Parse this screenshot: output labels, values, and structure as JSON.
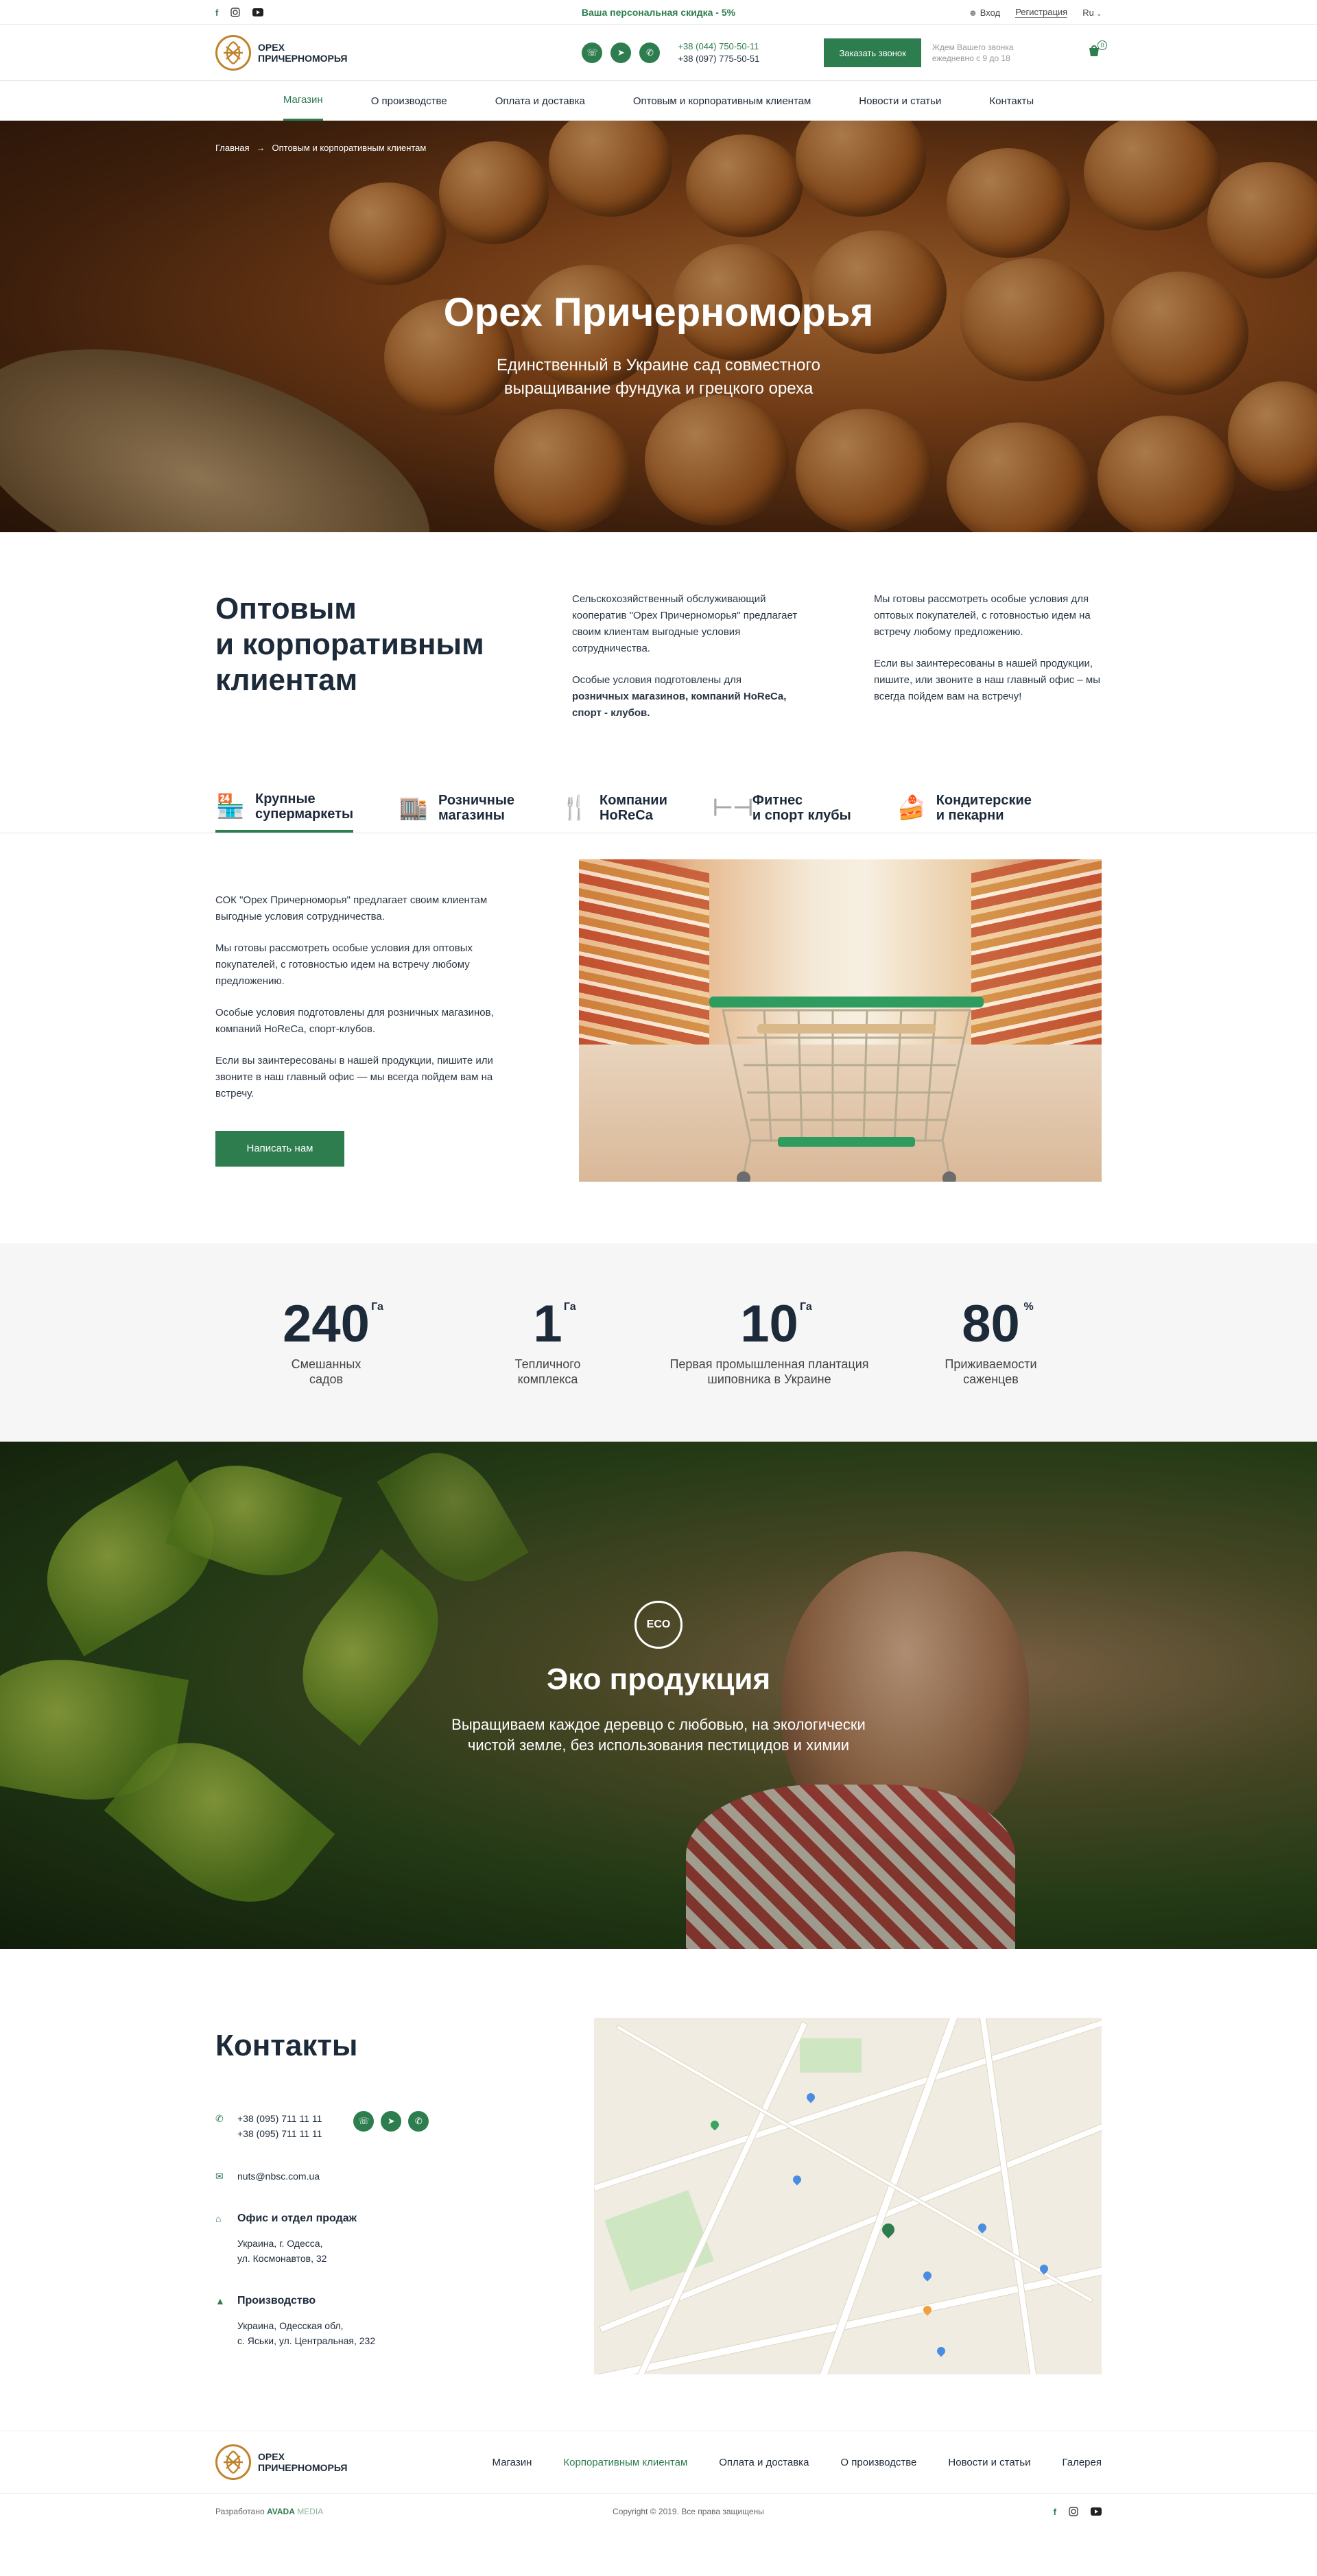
{
  "topbar": {
    "promo": "Ваша персональная скидка - 5%",
    "login": "Вход",
    "register": "Регистрация",
    "lang": "Ru"
  },
  "header": {
    "logo_line1": "ОРЕХ",
    "logo_line2": "ПРИЧЕРНОМОРЬЯ",
    "phone1": "+38 (044) 750-50-11",
    "phone2": "+38 (097) 775-50-51",
    "call_button": "Заказать звонок",
    "wait_text": "Ждем Вашего звонка ежедневно с 9 до 18",
    "cart_count": "0"
  },
  "nav": [
    {
      "label": "Магазин"
    },
    {
      "label": "О производстве"
    },
    {
      "label": "Оплата и доставка"
    },
    {
      "label": "Оптовым и корпоративным клиентам"
    },
    {
      "label": "Новости и статьи"
    },
    {
      "label": "Контакты"
    }
  ],
  "hero": {
    "crumb_home": "Главная",
    "crumb_current": "Оптовым и корпоративным клиентам",
    "title": "Орех Причерноморья",
    "subtitle_1": "Единственный в Украине сад совместного",
    "subtitle_2": "выращивание фундука и грецкого ореха"
  },
  "wholesale": {
    "title_1": "Оптовым",
    "title_2": "и корпоративным",
    "title_3": "клиентам",
    "col1_p1": "Сельскохозяйственный обслуживающий кооператив \"Орех Причерноморья\" предлагает своим клиентам выгодные условия сотрудничества.",
    "col1_p2a": "Особые условия подготовлены для ",
    "col1_p2b": "розничных магазинов, компаний HoReCa, спорт - клубов.",
    "col2_p1": "Мы готовы рассмотреть особые условия для оптовых покупателей, с готовностью идем на встречу любому предложению.",
    "col2_p2": "Если вы заинтересованы в нашей продукции, пишите, или звоните в наш главный офис – мы всегда пойдем вам на встречу!"
  },
  "tabs": [
    {
      "l1": "Крупные",
      "l2": "супермаркеты"
    },
    {
      "l1": "Розничные",
      "l2": "магазины"
    },
    {
      "l1": "Компании",
      "l2": "HoReCa"
    },
    {
      "l1": "Фитнес",
      "l2": "и спорт клубы"
    },
    {
      "l1": "Кондитерские",
      "l2": "и пекарни"
    }
  ],
  "tab_content": {
    "p1": "СОК \"Орех Причерноморья\" предлагает своим клиентам выгодные условия сотрудничества.",
    "p2": "Мы готовы рассмотреть особые условия для оптовых покупателей, с готовностью идем на встречу любому предложению.",
    "p3": "Особые условия подготовлены для розничных магазинов, компаний HoReCa, спорт-клубов.",
    "p4": "Если вы заинтересованы в нашей продукции, пишите или звоните в наш главный офис — мы всегда пойдем вам на встречу.",
    "button": "Написать нам"
  },
  "stats": [
    {
      "num": "240",
      "unit": "Га",
      "l1": "Смешанных",
      "l2": "садов"
    },
    {
      "num": "1",
      "unit": "Га",
      "l1": "Тепличного",
      "l2": "комплекса"
    },
    {
      "num": "10",
      "unit": "Га",
      "l1": "Первая промышленная плантация",
      "l2": "шиповника в Украине"
    },
    {
      "num": "80",
      "unit": "%",
      "l1": "Приживаемости",
      "l2": "саженцев"
    }
  ],
  "eco": {
    "icon_label": "ECO",
    "title": "Эко продукция",
    "sub_1": "Выращиваем каждое деревцо с любовью, на экологически",
    "sub_2": "чистой земле, без использования пестицидов и химии"
  },
  "contacts": {
    "title": "Контакты",
    "phone1": "+38 (095) 711 11 11",
    "phone2": "+38 (095) 711 11 11",
    "email": "nuts@nbsc.com.ua",
    "office_title": "Офис и отдел продаж",
    "office_1": "Украина, г. Одесса,",
    "office_2": "ул. Космонавтов, 32",
    "prod_title": "Производство",
    "prod_1": "Украина, Одесская обл,",
    "prod_2": "с. Яськи, ул. Центральная, 232"
  },
  "footer": {
    "nav": [
      {
        "label": "Магазин"
      },
      {
        "label": "Корпоративным клиентам"
      },
      {
        "label": "Оплата и доставка"
      },
      {
        "label": "О производстве"
      },
      {
        "label": "Новости и статьи"
      },
      {
        "label": "Галерея"
      }
    ],
    "dev_prefix": "Разработано",
    "dev_a": "AVADA",
    "dev_b": "MEDIA",
    "copyright": "Copyright © 2019. Все права защищены"
  },
  "colors": {
    "accent": "#2e7d4f",
    "dark": "#1d2a3a",
    "brand_gold": "#c0822a"
  },
  "icons": [
    "facebook-icon",
    "instagram-icon",
    "youtube-icon",
    "viber-icon",
    "telegram-icon",
    "whatsapp-icon",
    "user-icon",
    "cart-icon",
    "phone-icon",
    "mail-icon",
    "home-icon",
    "tree-icon"
  ]
}
